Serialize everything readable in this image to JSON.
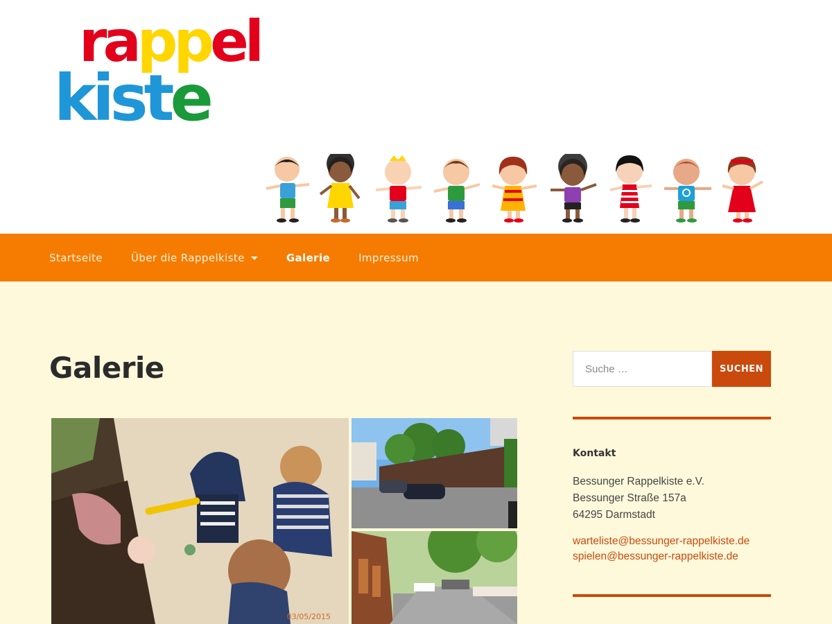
{
  "logo": {
    "line1": [
      {
        "char": "r",
        "color": "#e3001b"
      },
      {
        "char": "a",
        "color": "#e3001b"
      },
      {
        "char": "p",
        "color": "#ffd600"
      },
      {
        "char": "p",
        "color": "#ffd600"
      },
      {
        "char": "e",
        "color": "#e3001b"
      },
      {
        "char": "l",
        "color": "#e3001b"
      }
    ],
    "line2": [
      {
        "char": "k",
        "color": "#1e96d8"
      },
      {
        "char": "i",
        "color": "#1e96d8"
      },
      {
        "char": "s",
        "color": "#1e96d8"
      },
      {
        "char": "t",
        "color": "#1e96d8"
      },
      {
        "char": "e",
        "color": "#1a9a3a"
      }
    ]
  },
  "nav": {
    "items": [
      {
        "label": "Startseite",
        "active": false
      },
      {
        "label": "Über die Rappelkiste",
        "active": false,
        "has_dropdown": true
      },
      {
        "label": "Galerie",
        "active": true
      },
      {
        "label": "Impressum",
        "active": false
      }
    ]
  },
  "page": {
    "title": "Galerie"
  },
  "gallery": {
    "photo_date": "03/05/2015"
  },
  "sidebar": {
    "search": {
      "placeholder": "Suche …",
      "button_label": "SUCHEN"
    },
    "contact": {
      "title": "Kontakt",
      "address_lines": [
        "Bessunger Rappelkiste e.V.",
        "Bessunger Straße 157a",
        "64295 Darmstadt"
      ],
      "emails": [
        "warteliste@bessunger-rappelkiste.de",
        "spielen@bessunger-rappelkiste.de"
      ]
    }
  },
  "colors": {
    "nav_bg": "#f57c00",
    "content_bg": "#fff9dc",
    "accent": "#c94a0c"
  }
}
